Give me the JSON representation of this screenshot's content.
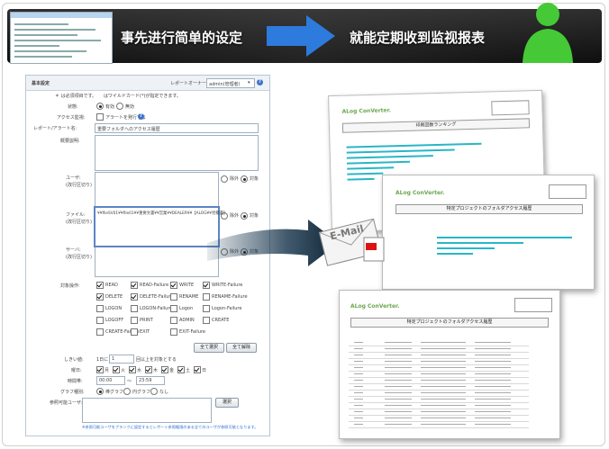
{
  "header": {
    "left_caption": "事先进行简单的设定",
    "right_caption": "就能定期收到监视报表"
  },
  "form": {
    "section_title": "基本設定",
    "owner_label": "レポートオーナー:",
    "owner_value": "admin(管理者)",
    "required_note_a": "＊ は必須項目です。",
    "wildcard_note": "はワイルドカード(*)が指定できます。",
    "state_label": "状態:",
    "state_on": "有効",
    "state_off": "無効",
    "access_alert_label": "アクセス監視:",
    "access_alert_text": "アラートを発行する",
    "report_name_label": "レポート/アラート名:",
    "report_name_value": "重要フォルダへのアクセス履歴",
    "description_label": "概要説明:",
    "user_label": "ユーザ:",
    "user_sub": "(改行区切り)",
    "file_label": "ファイル:",
    "file_sub": "(改行区切り)",
    "file_value": "¥¥fileSV01¥¥file01¥¥重要文書¥¥営業¥¥DEALER¥¥【ALOG¥¥見積書】",
    "server_label": "サーバ:",
    "server_sub": "(改行区切り)",
    "exclude": "除外",
    "target": "対象",
    "ops_label": "対象操作:",
    "ops": [
      {
        "label": "READ",
        "checked": true
      },
      {
        "label": "READ-Failure",
        "checked": true
      },
      {
        "label": "WRITE",
        "checked": true
      },
      {
        "label": "WRITE-Failure",
        "checked": true
      },
      {
        "label": "DELETE",
        "checked": true
      },
      {
        "label": "DELETE-Failure",
        "checked": true
      },
      {
        "label": "RENAME",
        "checked": false
      },
      {
        "label": "RENAME-Failure",
        "checked": false
      },
      {
        "label": "LOGON",
        "checked": false
      },
      {
        "label": "LOGON-Failure",
        "checked": false
      },
      {
        "label": "Logon",
        "checked": false
      },
      {
        "label": "Logon-Failure",
        "checked": false
      },
      {
        "label": "LOGOFF",
        "checked": false
      },
      {
        "label": "PRINT",
        "checked": false
      },
      {
        "label": "ADMIN",
        "checked": false
      },
      {
        "label": "CREATE",
        "checked": false
      },
      {
        "label": "CREATE-Failure",
        "checked": false
      },
      {
        "label": "EXIT",
        "checked": false
      },
      {
        "label": "EXIT-Failure",
        "checked": false
      }
    ],
    "select_all": "全て選択",
    "clear_all": "全て解除",
    "threshold_label": "しきい値:",
    "threshold_prefix": "1日に",
    "threshold_value": "1",
    "threshold_suffix": "回以上を対象とする",
    "weekday_label": "曜日:",
    "weekdays": [
      "月",
      "火",
      "水",
      "木",
      "金",
      "土",
      "日"
    ],
    "time_label": "時間帯:",
    "time_from": "00:00",
    "time_tilde": "～",
    "time_to": "23:59",
    "graph_label": "グラフ種別:",
    "graph_bar": "棒グラフ",
    "graph_pie": "円グラフ",
    "graph_none": "なし",
    "viewer_label": "参照可能ユーザ:",
    "browse": "選択",
    "footnote": "※参照可能ユーザをブランクに設定するとレポート参照権限のある全てのユーザが参照可能となります。"
  },
  "reports": {
    "logo": "ALog ConVerter.",
    "doc1_title": "印刷回数ランキング",
    "doc2_title": "特定プロジェクトのフォルダアクセス履歴",
    "doc3_title": "特定プロジェクトのフォルダアクセス履歴",
    "email_label": "E-Mail"
  },
  "colors": {
    "accent": "#2f6fd6",
    "bar": "#29b6c6",
    "logo": "#6aa84f",
    "person": "#46c936"
  }
}
